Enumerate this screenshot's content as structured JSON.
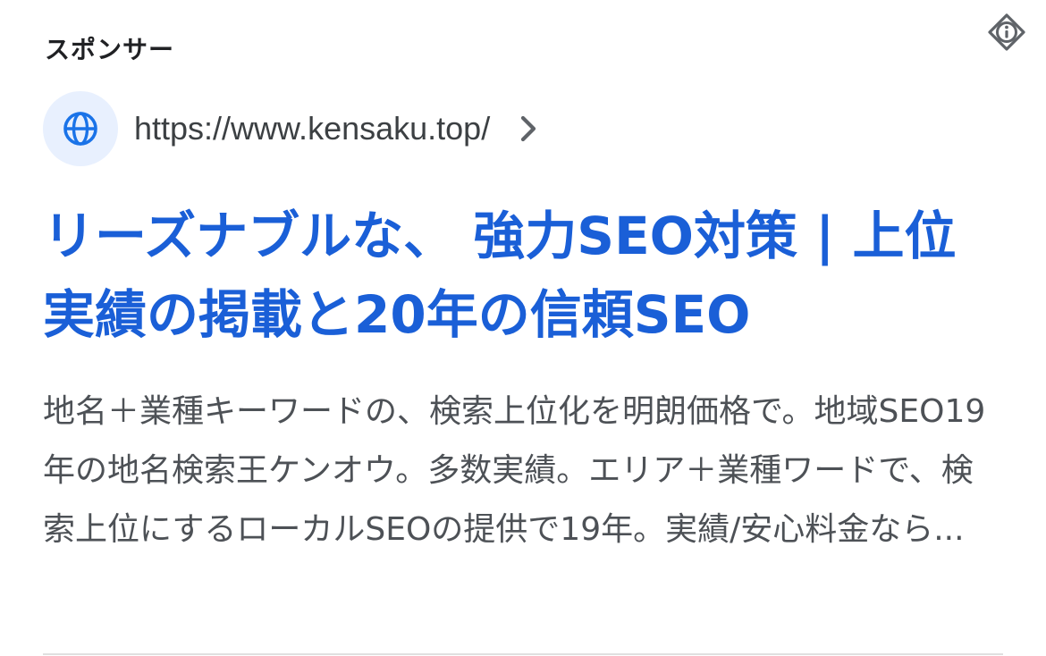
{
  "ad": {
    "sponsor_label": "スポンサー",
    "url": "https://www.kensaku.top/",
    "title": "リーズナブルな、 強力SEO対策 | 上位実績の掲載と20年の信頼SEO",
    "description": "地名＋業種キーワードの、検索上位化を明朗価格で。地域SEO19年の地名検索王ケンオウ。多数実績。エリア＋業種ワードで、検索上位にするローカルSEOの提供で19年。実績/安心料金なら..."
  },
  "icons": {
    "info": "info-diamond-icon",
    "favicon": "globe-icon",
    "chevron": "chevron-right-icon"
  },
  "colors": {
    "title": "#1a5fd7",
    "favicon_bg": "#e8f0fe",
    "globe": "#1a73e8",
    "text_primary": "#202124",
    "text_secondary": "#4d5156"
  }
}
